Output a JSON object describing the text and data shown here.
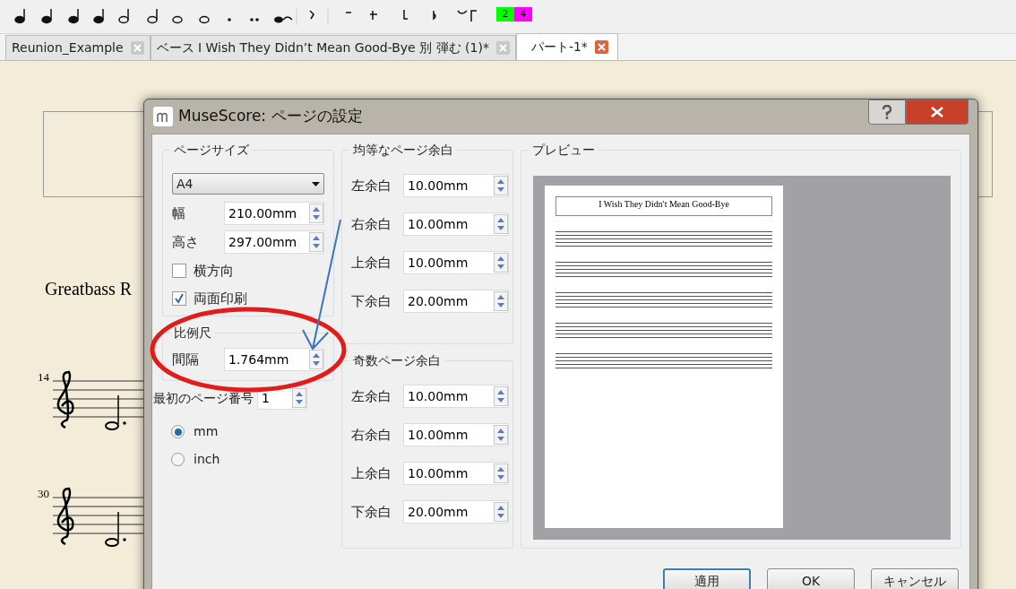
{
  "toolbar": {
    "voices": [
      {
        "label": "2",
        "color": "#00ff00"
      },
      {
        "label": "4",
        "color": "#ff00ff"
      }
    ]
  },
  "tabs": [
    {
      "label": "Reunion_Example",
      "selected": false
    },
    {
      "label": "ベース I Wish They Didn’t Mean Good-Bye 別 弾む (1)*",
      "selected": false
    },
    {
      "label": "パート-1*",
      "selected": true
    }
  ],
  "score": {
    "instrument_label": "Greatbass R",
    "measure_numbers": [
      "14",
      "30"
    ]
  },
  "dialog": {
    "title": "MuseScore: ページの設定",
    "page_size": {
      "legend": "ページサイズ",
      "paper": "A4",
      "fields": [
        {
          "label": "幅",
          "value": "210.00mm"
        },
        {
          "label": "高さ",
          "value": "297.00mm"
        }
      ],
      "checkboxes": [
        {
          "label": "横方向",
          "checked": false
        },
        {
          "label": "両面印刷",
          "checked": true
        }
      ]
    },
    "scale": {
      "legend": "比例尺",
      "label": "間隔",
      "value": "1.764mm"
    },
    "first_page": {
      "label": "最初のページ番号",
      "value": "1"
    },
    "units": [
      {
        "label": "mm",
        "selected": true
      },
      {
        "label": "inch",
        "selected": false
      }
    ],
    "even_margins": {
      "legend": "均等なページ余白",
      "fields": [
        {
          "label": "左余白",
          "value": "10.00mm"
        },
        {
          "label": "右余白",
          "value": "10.00mm"
        },
        {
          "label": "上余白",
          "value": "10.00mm"
        },
        {
          "label": "下余白",
          "value": "20.00mm"
        }
      ]
    },
    "odd_margins": {
      "legend": "奇数ページ余白",
      "fields": [
        {
          "label": "左余白",
          "value": "10.00mm"
        },
        {
          "label": "右余白",
          "value": "10.00mm"
        },
        {
          "label": "上余白",
          "value": "10.00mm"
        },
        {
          "label": "下余白",
          "value": "20.00mm"
        }
      ]
    },
    "preview": {
      "legend": "プレビュー",
      "title": "I Wish They Didn't Mean Good-Bye"
    },
    "buttons": [
      {
        "label": "適用",
        "kind": "default"
      },
      {
        "label": "OK",
        "kind": "normal"
      },
      {
        "label": "キャンセル",
        "kind": "normal"
      }
    ]
  }
}
